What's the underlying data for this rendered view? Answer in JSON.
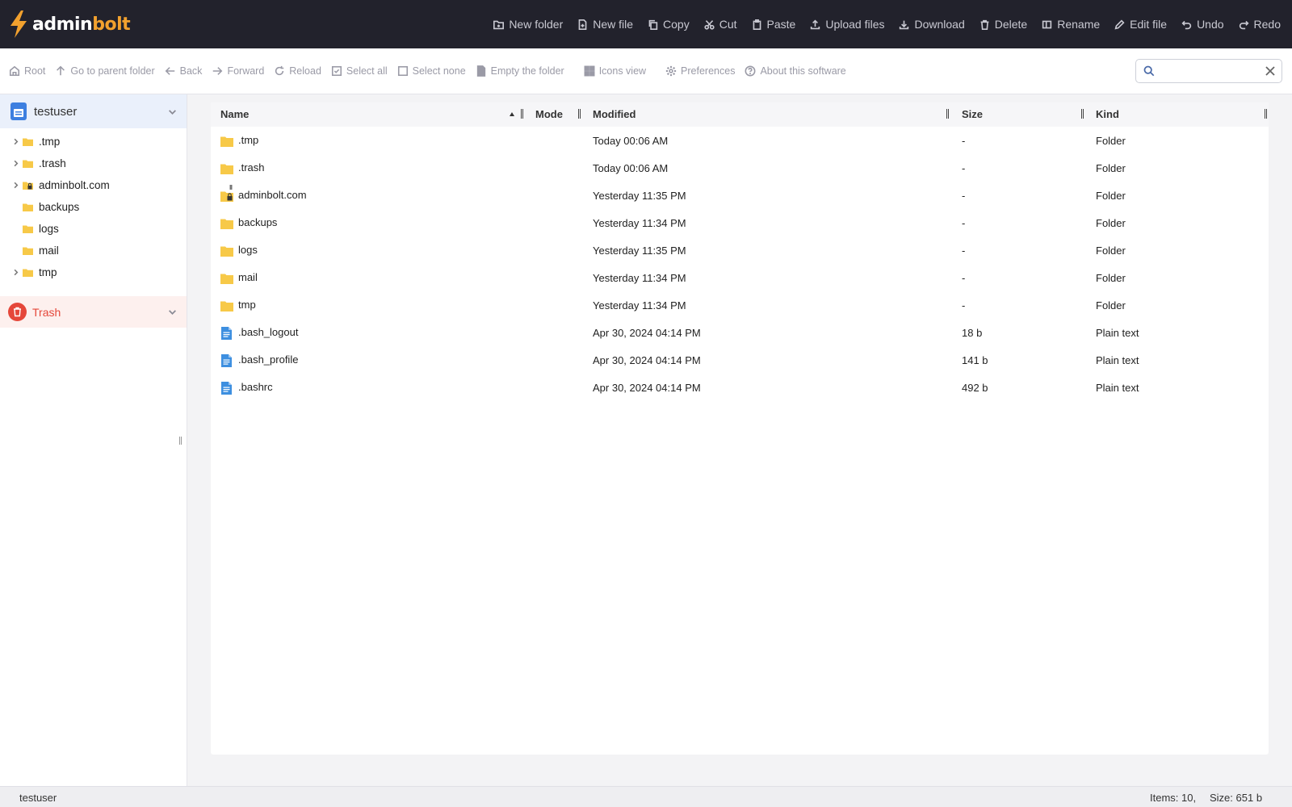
{
  "app": {
    "logo_part1": "admin",
    "logo_part2": "bolt",
    "brand_color": "#f2a12e"
  },
  "top_actions": [
    {
      "label": "New folder",
      "icon": "new-folder-icon"
    },
    {
      "label": "New file",
      "icon": "new-file-icon"
    },
    {
      "label": "Copy",
      "icon": "copy-icon"
    },
    {
      "label": "Cut",
      "icon": "scissors-icon"
    },
    {
      "label": "Paste",
      "icon": "clipboard-icon"
    },
    {
      "label": "Upload files",
      "icon": "upload-icon"
    },
    {
      "label": "Download",
      "icon": "download-icon"
    },
    {
      "label": "Delete",
      "icon": "trash-icon"
    },
    {
      "label": "Rename",
      "icon": "rename-icon"
    },
    {
      "label": "Edit file",
      "icon": "pencil-icon"
    },
    {
      "label": "Undo",
      "icon": "undo-icon"
    },
    {
      "label": "Redo",
      "icon": "redo-icon"
    }
  ],
  "toolbar": {
    "root": "Root",
    "parent": "Go to parent folder",
    "back": "Back",
    "forward": "Forward",
    "reload": "Reload",
    "select_all": "Select all",
    "select_none": "Select none",
    "empty_folder": "Empty the folder",
    "icons_view": "Icons view",
    "preferences": "Preferences",
    "about": "About this software",
    "search_value": "",
    "search_placeholder": ""
  },
  "sidebar": {
    "user": "testuser",
    "items": [
      {
        "label": ".tmp",
        "expandable": true,
        "locked": false
      },
      {
        "label": ".trash",
        "expandable": true,
        "locked": false
      },
      {
        "label": "adminbolt.com",
        "expandable": true,
        "locked": true
      },
      {
        "label": "backups",
        "expandable": false,
        "locked": false
      },
      {
        "label": "logs",
        "expandable": false,
        "locked": false
      },
      {
        "label": "mail",
        "expandable": false,
        "locked": false
      },
      {
        "label": "tmp",
        "expandable": true,
        "locked": false
      }
    ],
    "trash": "Trash"
  },
  "table": {
    "columns": {
      "name": "Name",
      "mode": "Mode",
      "modified": "Modified",
      "size": "Size",
      "kind": "Kind"
    },
    "sort": {
      "column": "name",
      "direction": "ascending"
    },
    "rows": [
      {
        "name": ".tmp",
        "type": "folder",
        "locked": false,
        "modified": "Today 00:06 AM",
        "size": "-",
        "kind": "Folder"
      },
      {
        "name": ".trash",
        "type": "folder",
        "locked": false,
        "modified": "Today 00:06 AM",
        "size": "-",
        "kind": "Folder"
      },
      {
        "name": "adminbolt.com",
        "type": "folder",
        "locked": true,
        "modified": "Yesterday 11:35 PM",
        "size": "-",
        "kind": "Folder"
      },
      {
        "name": "backups",
        "type": "folder",
        "locked": false,
        "modified": "Yesterday 11:34 PM",
        "size": "-",
        "kind": "Folder"
      },
      {
        "name": "logs",
        "type": "folder",
        "locked": false,
        "modified": "Yesterday 11:35 PM",
        "size": "-",
        "kind": "Folder"
      },
      {
        "name": "mail",
        "type": "folder",
        "locked": false,
        "modified": "Yesterday 11:34 PM",
        "size": "-",
        "kind": "Folder"
      },
      {
        "name": "tmp",
        "type": "folder",
        "locked": false,
        "modified": "Yesterday 11:34 PM",
        "size": "-",
        "kind": "Folder"
      },
      {
        "name": ".bash_logout",
        "type": "file",
        "locked": false,
        "modified": "Apr 30, 2024 04:14 PM",
        "size": "18 b",
        "kind": "Plain text"
      },
      {
        "name": ".bash_profile",
        "type": "file",
        "locked": false,
        "modified": "Apr 30, 2024 04:14 PM",
        "size": "141 b",
        "kind": "Plain text"
      },
      {
        "name": ".bashrc",
        "type": "file",
        "locked": false,
        "modified": "Apr 30, 2024 04:14 PM",
        "size": "492 b",
        "kind": "Plain text"
      }
    ]
  },
  "status": {
    "path": "testuser",
    "items": "Items: 10,",
    "size": "Size: 651 b"
  },
  "colors": {
    "folder": "#f7c948",
    "file": "#3d8fe0",
    "trash": "#e5473a",
    "topbar": "#22222c"
  }
}
